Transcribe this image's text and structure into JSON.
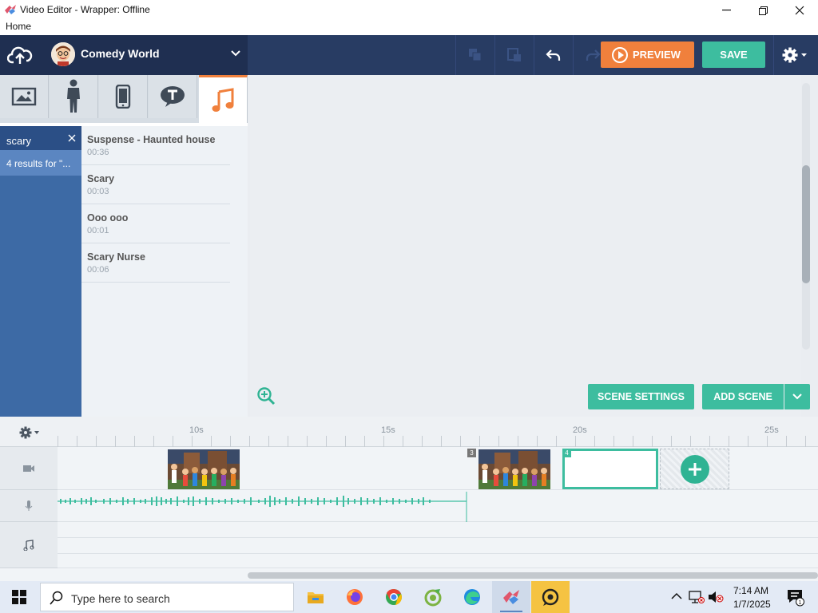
{
  "window": {
    "title": "Video Editor - Wrapper: Offline",
    "menu_home": "Home"
  },
  "toolbar": {
    "project_name": "Comedy World",
    "preview_label": "PREVIEW",
    "save_label": "SAVE",
    "colors": {
      "bar": "#283c63",
      "preview": "#f0803c",
      "save": "#3dbd9f"
    }
  },
  "asset_tabs": [
    {
      "icon": "image-icon",
      "active": false
    },
    {
      "icon": "character-icon",
      "active": false
    },
    {
      "icon": "phone-prop-icon",
      "active": false
    },
    {
      "icon": "text-bubble-icon",
      "active": false
    },
    {
      "icon": "music-note-icon",
      "active": true
    }
  ],
  "search": {
    "query": "scary",
    "results_label": "4 results for \"..."
  },
  "sounds": [
    {
      "name": "Suspense - Haunted house",
      "duration": "00:36"
    },
    {
      "name": "Scary",
      "duration": "00:03"
    },
    {
      "name": "Ooo ooo",
      "duration": "00:01"
    },
    {
      "name": "Scary Nurse",
      "duration": "00:06"
    }
  ],
  "stage": {
    "scene_settings_label": "SCENE SETTINGS",
    "add_scene_label": "ADD SCENE"
  },
  "timeline": {
    "ticks": [
      "10s",
      "15s",
      "20s",
      "25s"
    ],
    "scene_numbers": [
      "3",
      "4"
    ]
  },
  "taskbar": {
    "search_placeholder": "Type here to search",
    "time": "7:14 AM",
    "date": "1/7/2025"
  }
}
